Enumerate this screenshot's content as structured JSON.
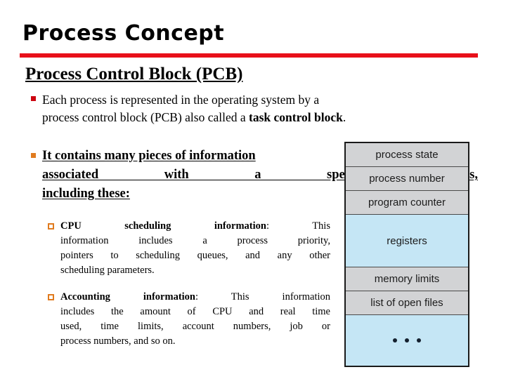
{
  "slide": {
    "title": "Process Concept",
    "accent_rule_color": "#e8101a",
    "section_heading": "Process Control Block (PCB)"
  },
  "bullets": [
    {
      "marker": "solid-square-bullet",
      "marker_color": "#cc0510",
      "style": "plain",
      "line1": "Each process is represented in the operating system by a",
      "line2_prefix": "process control block (PCB) also called a ",
      "line2_bold": "task control block",
      "line2_suffix": "."
    },
    {
      "marker": "solid-square-bullet",
      "marker_color": "#e07b1f",
      "style": "bold-underline",
      "line1": "It contains many pieces of information",
      "line2": "associated with a specific process,",
      "line3": "including these:"
    }
  ],
  "sub_bullets": [
    {
      "marker": "hollow-square-bullet",
      "marker_color": "#e07b1f",
      "lead_bold": "CPU scheduling information",
      "lead_colon": ":",
      "line1_tail": " This",
      "line2": "information includes a process priority,",
      "line3": "pointers to scheduling queues, and any other",
      "line4": "scheduling parameters."
    },
    {
      "marker": "hollow-square-bullet",
      "marker_color": "#e07b1f",
      "lead_bold": "Accounting information",
      "lead_colon": ":",
      "line1_tail": " This information",
      "line2": "includes the amount of CPU and real time",
      "line3": "used, time limits, account numbers, job or",
      "line4": "process numbers, and so on."
    }
  ],
  "pcb_diagram": {
    "name": "process-control-block",
    "gray_color": "#d2d3d5",
    "blue_color": "#c5e6f5",
    "border_color": "#1a1a1a",
    "rows": [
      {
        "label": "process state",
        "fill": "gray"
      },
      {
        "label": "process number",
        "fill": "gray"
      },
      {
        "label": "program counter",
        "fill": "gray"
      },
      {
        "label": "registers",
        "fill": "blue"
      },
      {
        "label": "memory limits",
        "fill": "gray"
      },
      {
        "label": "list of open files",
        "fill": "gray"
      },
      {
        "label": "",
        "fill": "blue",
        "glyph": "ellipsis-dots"
      }
    ]
  }
}
